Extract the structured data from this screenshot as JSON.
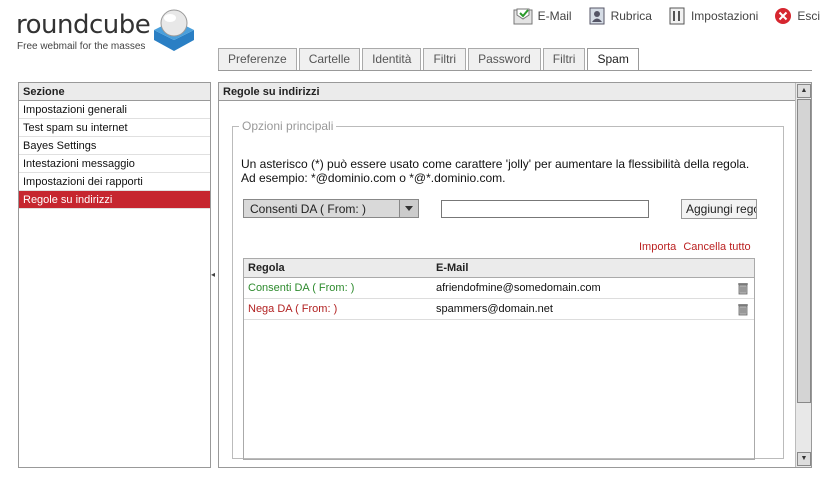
{
  "app": {
    "logo_text": "roundcube",
    "tagline": "Free webmail for the masses"
  },
  "topnav": [
    {
      "label": "E-Mail",
      "icon": "mail-icon"
    },
    {
      "label": "Rubrica",
      "icon": "addressbook-icon"
    },
    {
      "label": "Impostazioni",
      "icon": "settings-icon"
    },
    {
      "label": "Esci",
      "icon": "logout-icon"
    }
  ],
  "tabs": [
    "Preferenze",
    "Cartelle",
    "Identità",
    "Filtri",
    "Password",
    "Filtri",
    "Spam"
  ],
  "active_tab": "Spam",
  "sidebar": {
    "header": "Sezione",
    "items": [
      "Impostazioni generali",
      "Test spam su internet",
      "Bayes Settings",
      "Intestazioni messaggio",
      "Impostazioni dei rapporti",
      "Regole su indirizzi"
    ],
    "active_index": 5
  },
  "main": {
    "title": "Regole su indirizzi",
    "legend": "Opzioni principali",
    "description_line1": "Un asterisco (*) può essere usato come carattere 'jolly' per aumentare la flessibilità della regola.",
    "description_line2": "Ad esempio: *@dominio.com o *@*.dominio.com.",
    "select_value": "Consenti DA ( From: )",
    "email_value": "",
    "add_label": "Aggiungi regola",
    "import_label": "Importa",
    "clear_label": "Cancella tutto",
    "table": {
      "headers": [
        "Regola",
        "E-Mail"
      ],
      "rows": [
        {
          "rule": "Consenti DA ( From: )",
          "email": "afriendofmine@somedomain.com",
          "color": "#2e8b2e"
        },
        {
          "rule": "Nega DA ( From: )",
          "email": "spammers@domain.net",
          "color": "#b22222"
        }
      ]
    }
  },
  "colors": {
    "accent": "#c6262f",
    "allow": "#2e8b2e",
    "deny": "#b22222"
  }
}
